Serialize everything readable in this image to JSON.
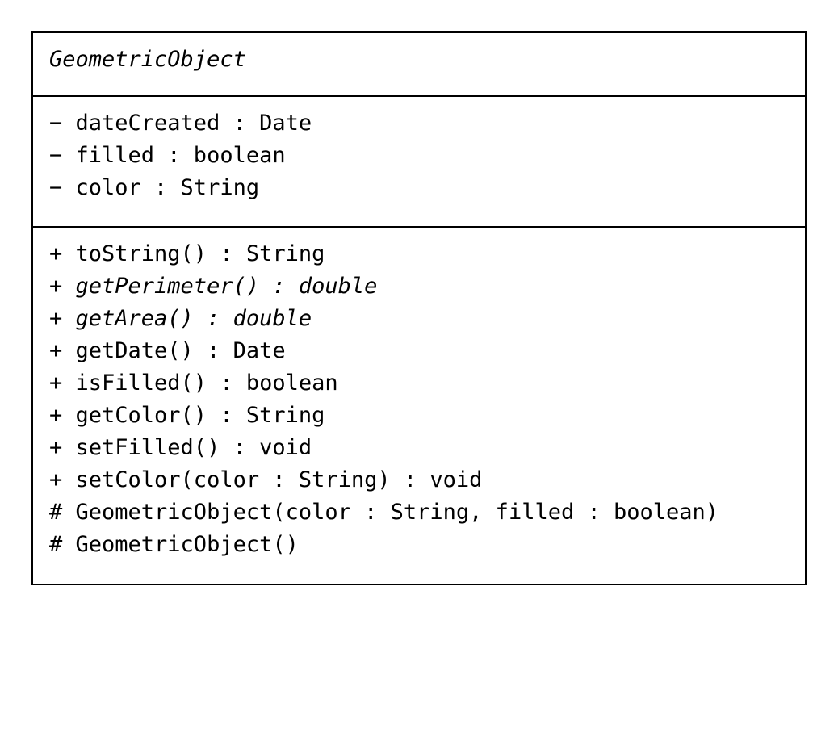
{
  "class": {
    "name": "GeometricObject",
    "name_italic": true,
    "attributes": [
      {
        "text": "− dateCreated : Date",
        "italic": false
      },
      {
        "text": "− filled : boolean",
        "italic": false
      },
      {
        "text": "− color : String",
        "italic": false
      }
    ],
    "operations": [
      {
        "text": "+ toString() : String",
        "italic": false
      },
      {
        "text": "+ getPerimeter() : double",
        "italic": true
      },
      {
        "text": "+ getArea() : double",
        "italic": true
      },
      {
        "text": "+ getDate() : Date",
        "italic": false
      },
      {
        "text": "+ isFilled() : boolean",
        "italic": false
      },
      {
        "text": "+ getColor() : String",
        "italic": false
      },
      {
        "text": "+ setFilled() : void",
        "italic": false
      },
      {
        "text": "+ setColor(color : String) : void",
        "italic": false
      },
      {
        "text": "# GeometricObject(color : String, filled : boolean)",
        "italic": false
      },
      {
        "text": "# GeometricObject()",
        "italic": false
      }
    ]
  },
  "colors": {
    "border": "#000000",
    "text": "#000000",
    "background": "#ffffff"
  }
}
